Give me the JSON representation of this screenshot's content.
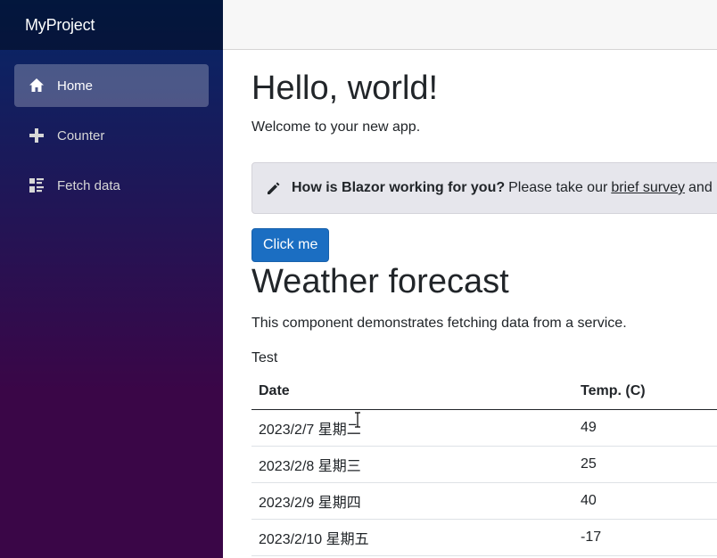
{
  "app": {
    "title": "MyProject"
  },
  "sidebar": {
    "items": [
      {
        "label": "Home",
        "icon": "home-icon",
        "active": true
      },
      {
        "label": "Counter",
        "icon": "plus-icon",
        "active": false
      },
      {
        "label": "Fetch data",
        "icon": "list-rich-icon",
        "active": false
      }
    ]
  },
  "main": {
    "heading": "Hello, world!",
    "welcome": "Welcome to your new app.",
    "survey": {
      "icon": "pencil-icon",
      "question": "How is Blazor working for you?",
      "prefix": "Please take our",
      "link": "brief survey",
      "suffix": "and"
    },
    "click_button": "Click me",
    "weather_heading": "Weather forecast",
    "weather_desc": "This component demonstrates fetching data from a service.",
    "test_label": "Test",
    "table": {
      "columns": [
        "Date",
        "Temp. (C)"
      ],
      "rows": [
        {
          "date": "2023/2/7 星期二",
          "temp": "49"
        },
        {
          "date": "2023/2/8 星期三",
          "temp": "25"
        },
        {
          "date": "2023/2/9 星期四",
          "temp": "40"
        },
        {
          "date": "2023/2/10 星期五",
          "temp": "-17"
        }
      ]
    }
  },
  "colors": {
    "sidebar_top": "#052767",
    "sidebar_bottom": "#3a0647",
    "button": "#1b6ec2"
  }
}
